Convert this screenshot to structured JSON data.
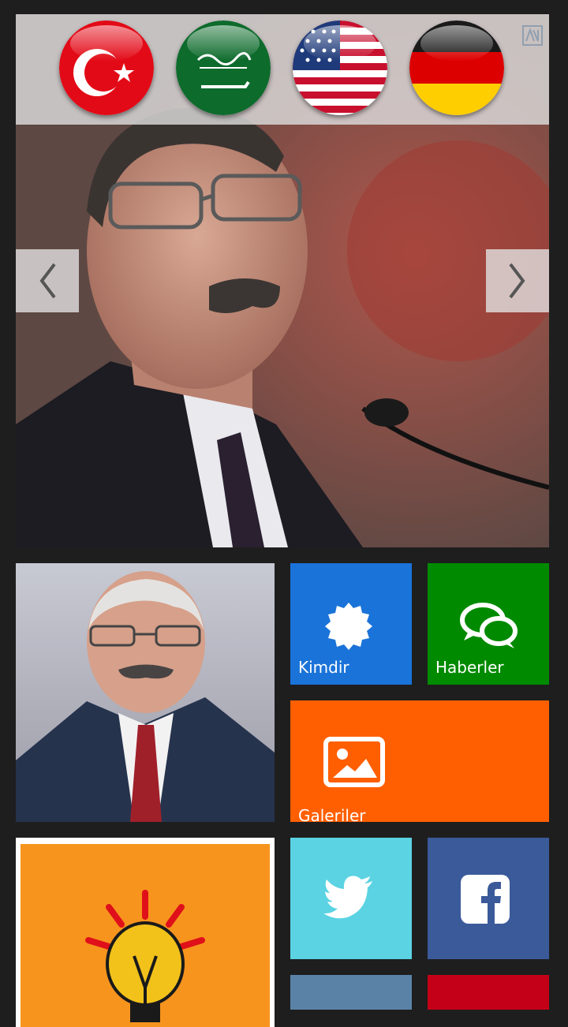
{
  "header": {
    "flags": [
      {
        "name": "Turkish",
        "icon": "turkey-flag-icon"
      },
      {
        "name": "Arabic",
        "icon": "saudi-flag-icon"
      },
      {
        "name": "English",
        "icon": "usa-flag-icon"
      },
      {
        "name": "German",
        "icon": "germany-flag-icon"
      }
    ]
  },
  "slider": {
    "prev_icon": "chevron-left-icon",
    "next_icon": "chevron-right-icon"
  },
  "tiles": {
    "kimdir": {
      "label": "Kimdir",
      "color": "#1a73d9",
      "icon": "badge-icon"
    },
    "haberler": {
      "label": "Haberler",
      "color": "#008a00",
      "icon": "chat-bubbles-icon"
    },
    "galeriler": {
      "label": "Galeriler",
      "color": "#ff5f00",
      "icon": "image-icon"
    },
    "twitter": {
      "color": "#5bd3e3",
      "icon": "twitter-icon"
    },
    "facebook": {
      "color": "#3a5a9a",
      "icon": "facebook-icon"
    },
    "extra1": {
      "color": "#5a82a6"
    },
    "extra2": {
      "color": "#c40018"
    }
  }
}
